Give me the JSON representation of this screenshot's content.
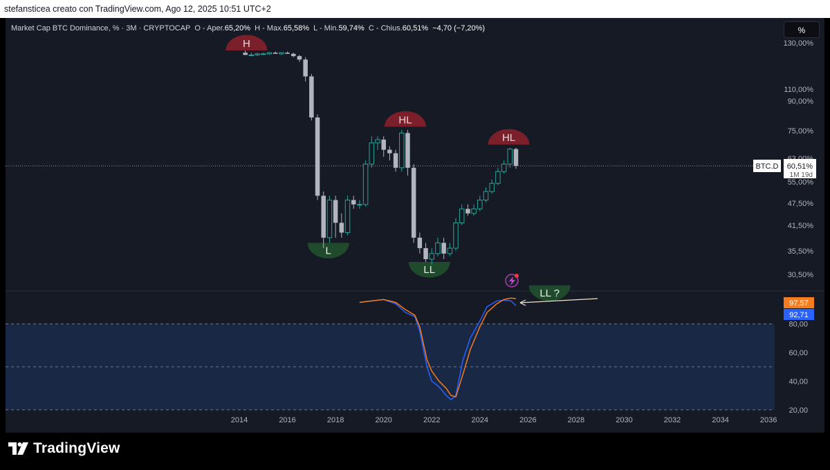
{
  "header": {
    "text": "stefansticea creato con TradingView.com, Ago 12, 2025 10:51 UTC+2"
  },
  "legend": {
    "symbol": "Market Cap BTC Dominance, % · 3M · CRYPTOCAP",
    "open_label": "O - Aper.",
    "open": "65,20%",
    "high_label": "H - Max.",
    "high": "65,58%",
    "low_label": "L - Min.",
    "low": "59,74%",
    "close_label": "C - Chius.",
    "close": "60,51%",
    "change": "−4,70 (−7,20%)"
  },
  "scale_button": "%",
  "price_axis": {
    "ticks": [
      "130,00%",
      "110,00%",
      "90,00%",
      "75,00%",
      "63,00%",
      "55,00%",
      "47,50%",
      "41,50%",
      "35,50%",
      "30,50%"
    ],
    "ticker_label": "BTC.D",
    "last_price": "60,51%",
    "countdown": "1M 19d"
  },
  "osc_axis": {
    "ticks": [
      "80,00",
      "60,00",
      "40,00",
      "20,00"
    ],
    "value_orange": "97,57",
    "value_blue": "92,71",
    "color_orange": "#f57c1f",
    "color_blue": "#2962ff"
  },
  "time_axis": {
    "ticks": [
      "2014",
      "2016",
      "2018",
      "2020",
      "2022",
      "2024",
      "2026",
      "2028",
      "2030",
      "2032",
      "2034",
      "2036"
    ]
  },
  "annotations": {
    "H": "H",
    "HL1": "HL",
    "HL2": "HL",
    "L": "L",
    "LL": "LL",
    "LL2": "LL  ?"
  },
  "colors": {
    "bull": "#26a69a",
    "bear": "#b2b5be",
    "top_marker": "#7b1f2a",
    "bottom_marker": "#1f4a2c"
  },
  "logo": {
    "text": "TradingView"
  },
  "chart_data": {
    "type": "candlestick",
    "title": "Market Cap BTC Dominance, % · 3M · CRYPTOCAP",
    "y_scale": "log",
    "ylim": [
      28,
      135
    ],
    "xlim": [
      2012.5,
      2037
    ],
    "candles": [
      {
        "t": 2014.25,
        "o": 100,
        "h": 101,
        "l": 99,
        "c": 99
      },
      {
        "t": 2014.5,
        "o": 99,
        "h": 100,
        "l": 98.5,
        "c": 99
      },
      {
        "t": 2014.75,
        "o": 99,
        "h": 100,
        "l": 98.5,
        "c": 99.5
      },
      {
        "t": 2015.0,
        "o": 99.5,
        "h": 100,
        "l": 99,
        "c": 99.5
      },
      {
        "t": 2015.25,
        "o": 99.5,
        "h": 100,
        "l": 99,
        "c": 100
      },
      {
        "t": 2015.5,
        "o": 100,
        "h": 100.5,
        "l": 99.5,
        "c": 99.5
      },
      {
        "t": 2015.75,
        "o": 99.5,
        "h": 100,
        "l": 99,
        "c": 100
      },
      {
        "t": 2016.0,
        "o": 100,
        "h": 100.5,
        "l": 99.5,
        "c": 99.5
      },
      {
        "t": 2016.25,
        "o": 99.5,
        "h": 100,
        "l": 98,
        "c": 98.5
      },
      {
        "t": 2016.5,
        "o": 98.5,
        "h": 99,
        "l": 96,
        "c": 97
      },
      {
        "t": 2016.75,
        "o": 97,
        "h": 98,
        "l": 88,
        "c": 90
      },
      {
        "t": 2017.0,
        "o": 90,
        "h": 91,
        "l": 74,
        "c": 75
      },
      {
        "t": 2017.25,
        "o": 75,
        "h": 76,
        "l": 52,
        "c": 53
      },
      {
        "t": 2017.5,
        "o": 53,
        "h": 54,
        "l": 42,
        "c": 44
      },
      {
        "t": 2017.75,
        "o": 44,
        "h": 53,
        "l": 43,
        "c": 52
      },
      {
        "t": 2018.0,
        "o": 52,
        "h": 53,
        "l": 44,
        "c": 47
      },
      {
        "t": 2018.25,
        "o": 47,
        "h": 49,
        "l": 44,
        "c": 45
      },
      {
        "t": 2018.5,
        "o": 45,
        "h": 53,
        "l": 44.5,
        "c": 52
      },
      {
        "t": 2018.75,
        "o": 52,
        "h": 53,
        "l": 50,
        "c": 51
      },
      {
        "t": 2019.0,
        "o": 51,
        "h": 52,
        "l": 50,
        "c": 51
      },
      {
        "t": 2019.25,
        "o": 51,
        "h": 62,
        "l": 50.5,
        "c": 61
      },
      {
        "t": 2019.5,
        "o": 61,
        "h": 69,
        "l": 60,
        "c": 67
      },
      {
        "t": 2019.75,
        "o": 67,
        "h": 69,
        "l": 65,
        "c": 68
      },
      {
        "t": 2020.0,
        "o": 68,
        "h": 69,
        "l": 63,
        "c": 65
      },
      {
        "t": 2020.25,
        "o": 65,
        "h": 66,
        "l": 62,
        "c": 64
      },
      {
        "t": 2020.5,
        "o": 64,
        "h": 65,
        "l": 59,
        "c": 60
      },
      {
        "t": 2020.75,
        "o": 60,
        "h": 71,
        "l": 59,
        "c": 70
      },
      {
        "t": 2021.0,
        "o": 70,
        "h": 71,
        "l": 58,
        "c": 60
      },
      {
        "t": 2021.25,
        "o": 60,
        "h": 61,
        "l": 43,
        "c": 44
      },
      {
        "t": 2021.5,
        "o": 44,
        "h": 45,
        "l": 41,
        "c": 42
      },
      {
        "t": 2021.75,
        "o": 42,
        "h": 43,
        "l": 39.5,
        "c": 40
      },
      {
        "t": 2022.0,
        "o": 40,
        "h": 42,
        "l": 39,
        "c": 41
      },
      {
        "t": 2022.25,
        "o": 41,
        "h": 44,
        "l": 40.5,
        "c": 43
      },
      {
        "t": 2022.5,
        "o": 43,
        "h": 44,
        "l": 40,
        "c": 41
      },
      {
        "t": 2022.75,
        "o": 41,
        "h": 43,
        "l": 40.5,
        "c": 42
      },
      {
        "t": 2023.0,
        "o": 42,
        "h": 48,
        "l": 41.5,
        "c": 47
      },
      {
        "t": 2023.25,
        "o": 47,
        "h": 51,
        "l": 46.5,
        "c": 50
      },
      {
        "t": 2023.5,
        "o": 50,
        "h": 51,
        "l": 48.5,
        "c": 49
      },
      {
        "t": 2023.75,
        "o": 49,
        "h": 51,
        "l": 48.5,
        "c": 50
      },
      {
        "t": 2024.0,
        "o": 50,
        "h": 53,
        "l": 49.5,
        "c": 52
      },
      {
        "t": 2024.25,
        "o": 52,
        "h": 55,
        "l": 51.5,
        "c": 54
      },
      {
        "t": 2024.5,
        "o": 54,
        "h": 57,
        "l": 53.5,
        "c": 56
      },
      {
        "t": 2024.75,
        "o": 56,
        "h": 60,
        "l": 55.5,
        "c": 59
      },
      {
        "t": 2025.0,
        "o": 59,
        "h": 62,
        "l": 58.5,
        "c": 61
      },
      {
        "t": 2025.25,
        "o": 61,
        "h": 65.58,
        "l": 60,
        "c": 65.2
      },
      {
        "t": 2025.5,
        "o": 65.2,
        "h": 65.58,
        "l": 59.74,
        "c": 60.51
      }
    ],
    "last_value": 60.51,
    "oscillator": {
      "type": "line",
      "ylim": [
        18,
        102
      ],
      "levels": [
        80,
        50,
        20
      ],
      "series": [
        {
          "color": "#2962ff",
          "points": [
            [
              2019.0,
              95
            ],
            [
              2019.5,
              96
            ],
            [
              2020.0,
              97
            ],
            [
              2020.5,
              94
            ],
            [
              2020.9,
              88
            ],
            [
              2021.3,
              85
            ],
            [
              2021.5,
              75
            ],
            [
              2021.8,
              50
            ],
            [
              2022.0,
              40
            ],
            [
              2022.3,
              36
            ],
            [
              2022.6,
              30
            ],
            [
              2022.8,
              27
            ],
            [
              2023.0,
              30
            ],
            [
              2023.3,
              55
            ],
            [
              2023.6,
              70
            ],
            [
              2024.0,
              82
            ],
            [
              2024.3,
              92
            ],
            [
              2024.7,
              96
            ],
            [
              2025.0,
              96.5
            ],
            [
              2025.3,
              96
            ],
            [
              2025.5,
              92.71
            ]
          ]
        },
        {
          "color": "#f57c1f",
          "points": [
            [
              2019.0,
              95
            ],
            [
              2019.5,
              96
            ],
            [
              2020.0,
              97
            ],
            [
              2020.5,
              95
            ],
            [
              2020.9,
              90
            ],
            [
              2021.3,
              86
            ],
            [
              2021.5,
              78
            ],
            [
              2021.8,
              55
            ],
            [
              2022.0,
              47
            ],
            [
              2022.3,
              40
            ],
            [
              2022.6,
              35
            ],
            [
              2022.8,
              30
            ],
            [
              2023.0,
              29
            ],
            [
              2023.3,
              45
            ],
            [
              2023.6,
              62
            ],
            [
              2024.0,
              78
            ],
            [
              2024.3,
              88
            ],
            [
              2024.7,
              94
            ],
            [
              2025.0,
              97
            ],
            [
              2025.3,
              98
            ],
            [
              2025.5,
              97.57
            ]
          ]
        }
      ]
    },
    "annotations": [
      {
        "text": "H",
        "x": 2014.3,
        "y": 101,
        "kind": "top"
      },
      {
        "text": "L",
        "x": 2017.7,
        "y": 43,
        "kind": "bottom"
      },
      {
        "text": "HL",
        "x": 2020.9,
        "y": 72,
        "kind": "top"
      },
      {
        "text": "LL",
        "x": 2021.9,
        "y": 39.5,
        "kind": "bottom"
      },
      {
        "text": "HL",
        "x": 2025.2,
        "y": 66.5,
        "kind": "top"
      },
      {
        "text": "LL  ?",
        "x": 2026.9,
        "y": 35.6,
        "kind": "bottom"
      }
    ]
  }
}
